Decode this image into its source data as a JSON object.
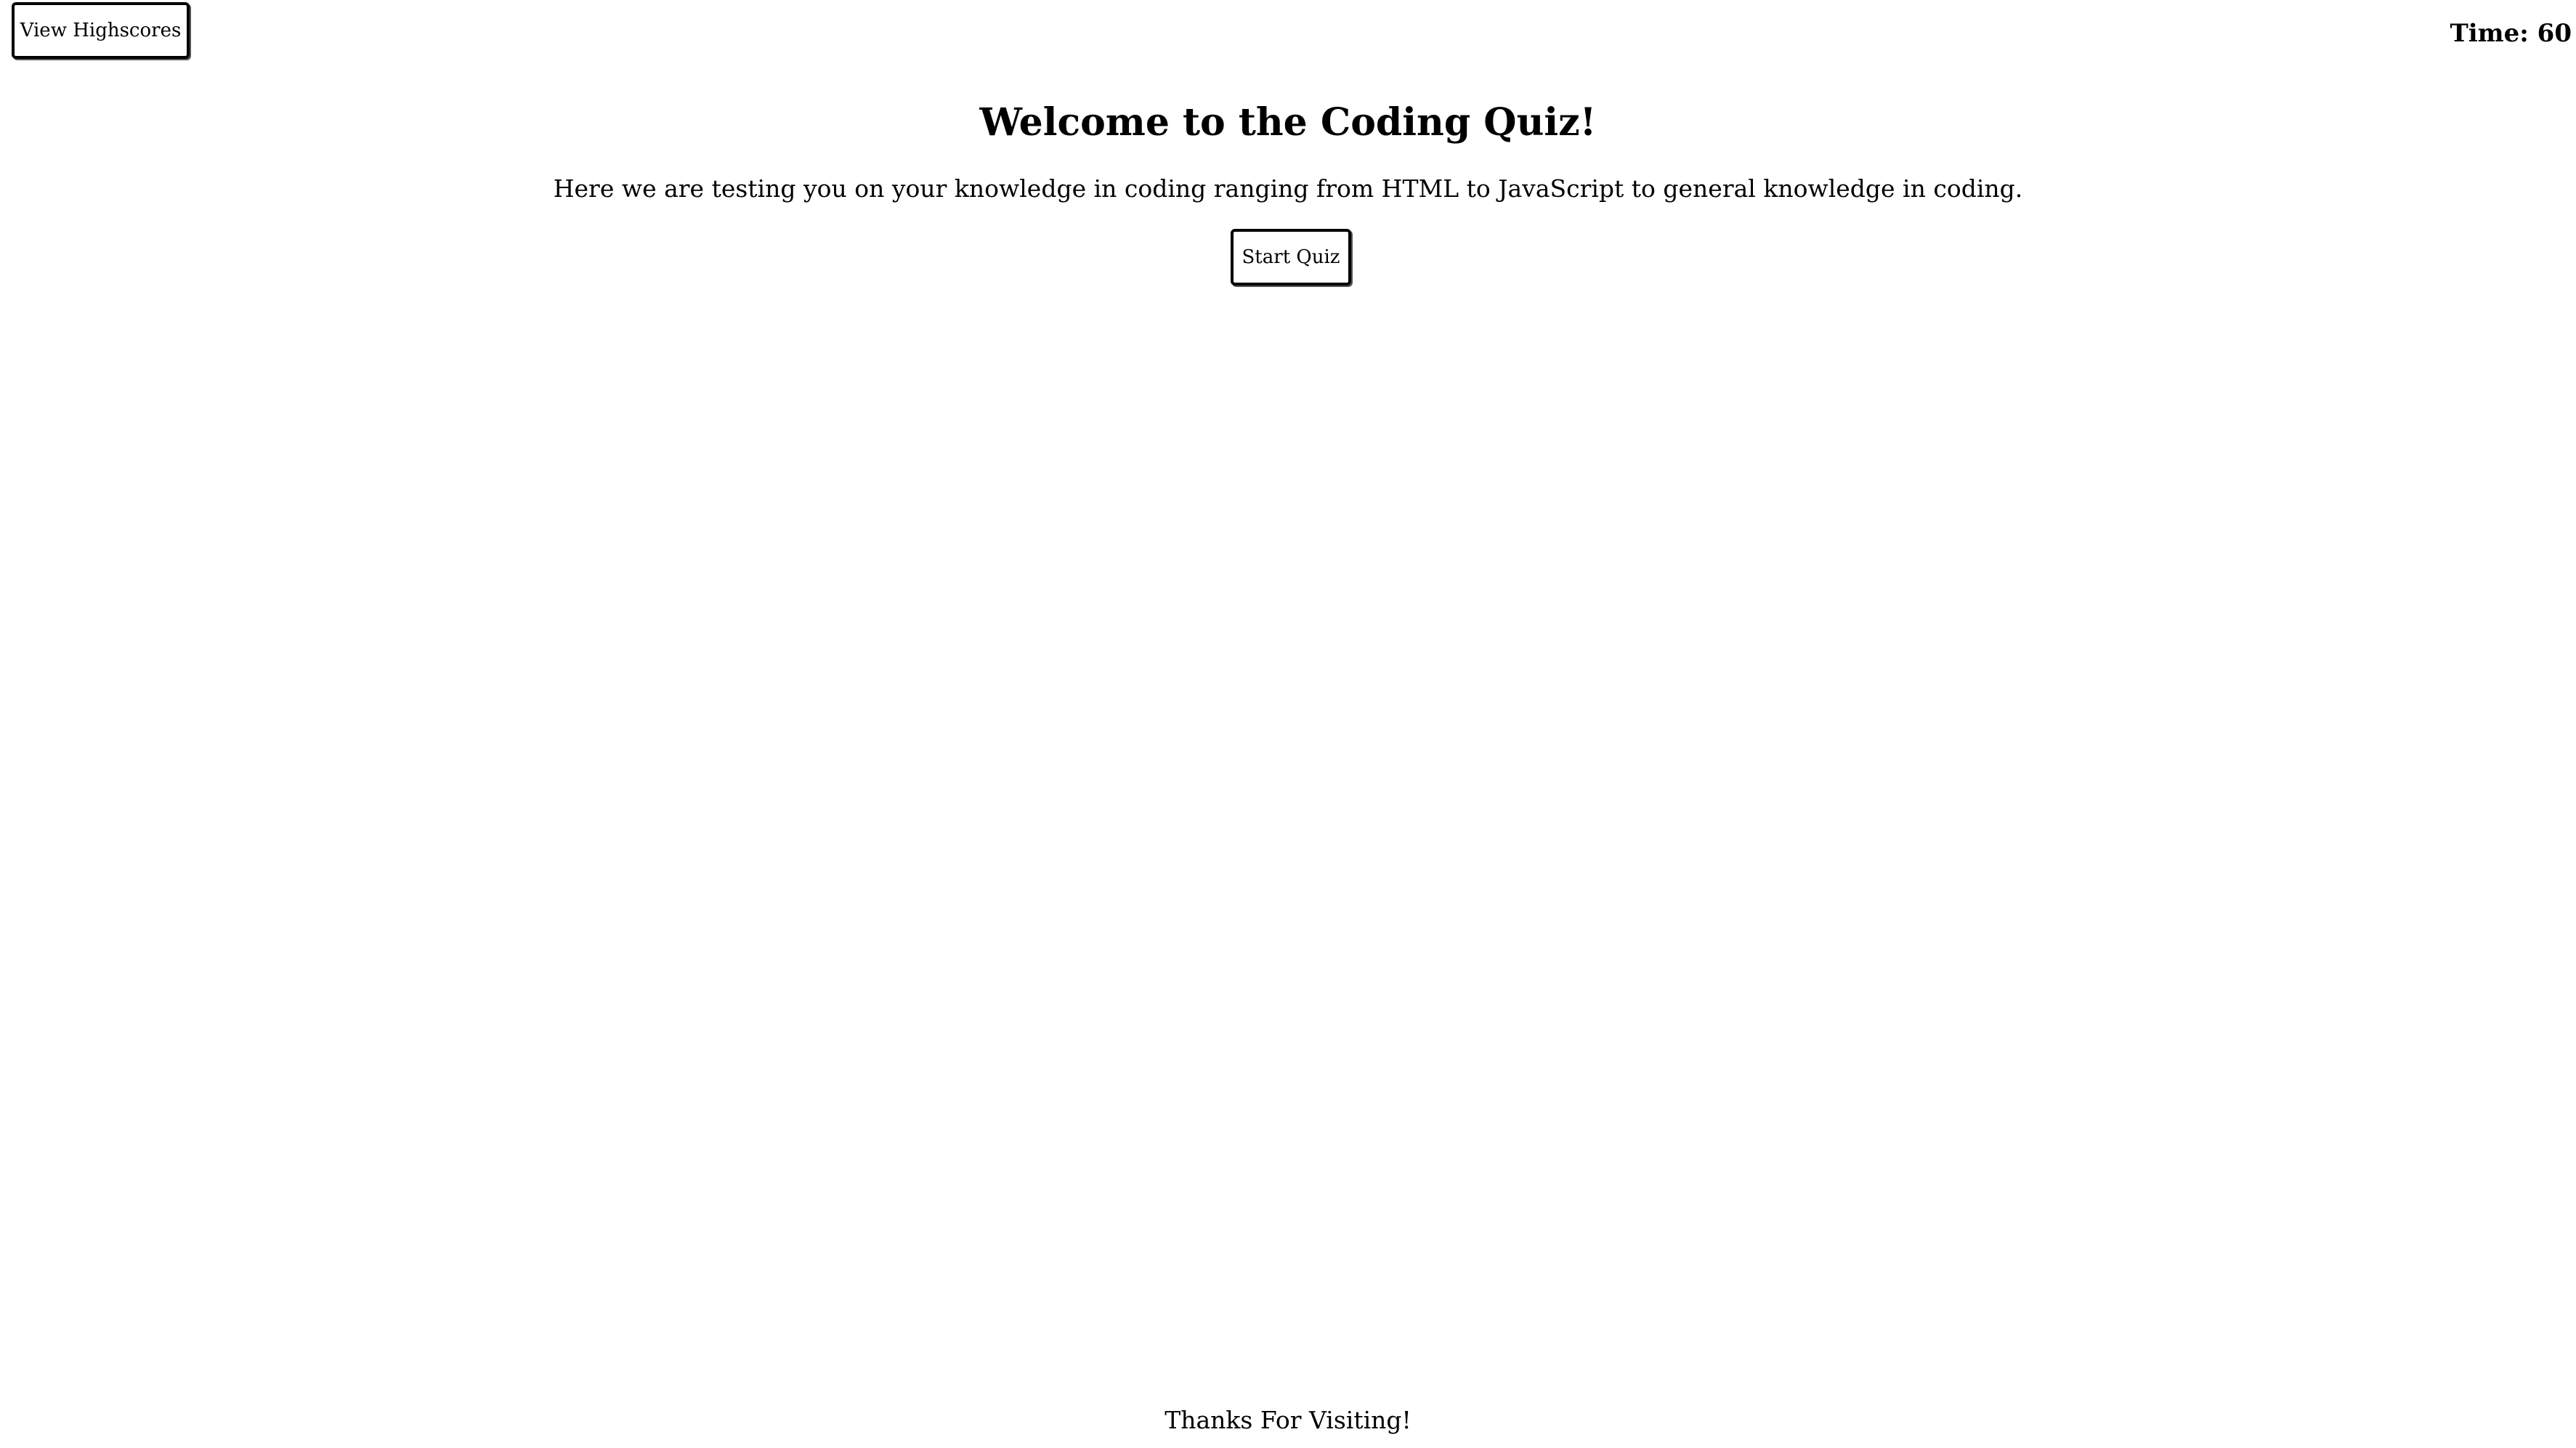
{
  "header": {
    "highscores_label": "View Highscores",
    "timer_text": "Time: 60"
  },
  "main": {
    "title": "Welcome to the Coding Quiz!",
    "intro": "Here we are testing you on your knowledge in coding ranging from HTML to JavaScript to general knowledge in coding.",
    "start_label": "Start Quiz"
  },
  "footer": {
    "text": "Thanks For Visiting!"
  }
}
